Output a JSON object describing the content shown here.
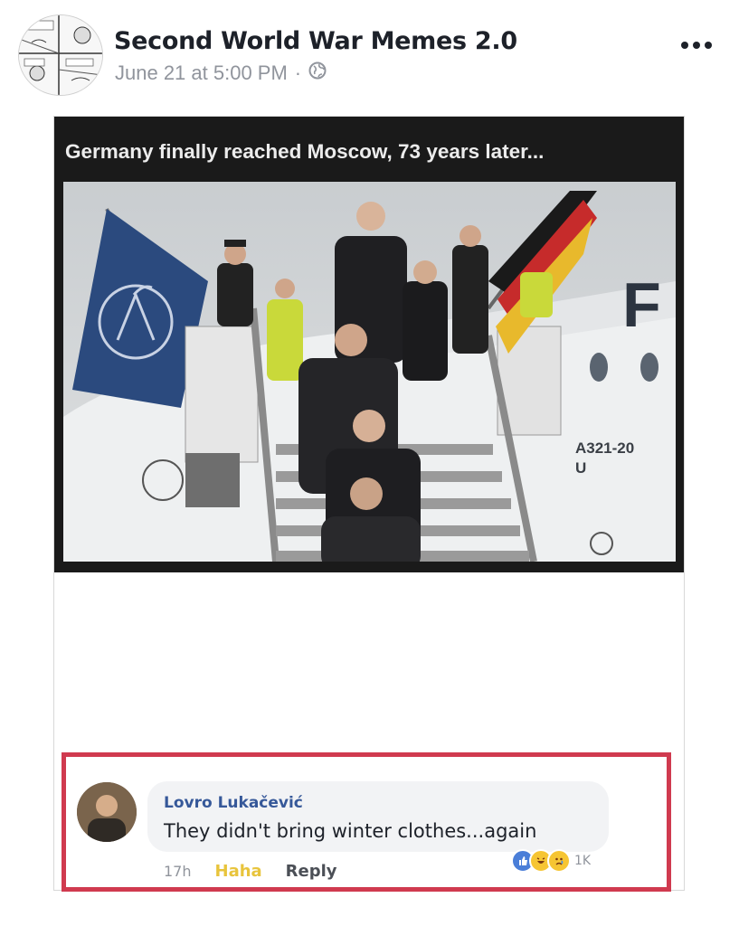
{
  "post": {
    "page_name": "Second World War Memes 2.0",
    "timestamp": "June 21 at 5:00 PM",
    "separator": "·",
    "privacy_icon": "globe-icon",
    "more_icon": "ellipsis-icon"
  },
  "meme": {
    "caption": "Germany finally reached Moscow, 73 years later...",
    "aircraft_marking": "A321-20",
    "aircraft_marking_2": "U",
    "fuselage_letter": "F"
  },
  "comment": {
    "author": "Lovro Lukačević",
    "text": "They didn't bring winter clothes...again",
    "time": "17h",
    "haha_label": "Haha",
    "reply_label": "Reply",
    "reaction_count": "1K",
    "reaction_icons": [
      "like-icon",
      "haha-icon",
      "sad-icon"
    ],
    "highlight_color": "#d03a4f"
  },
  "colors": {
    "name": "#1d2129",
    "meta": "#90949c",
    "link": "#365899",
    "haha": "#e8c43c"
  }
}
